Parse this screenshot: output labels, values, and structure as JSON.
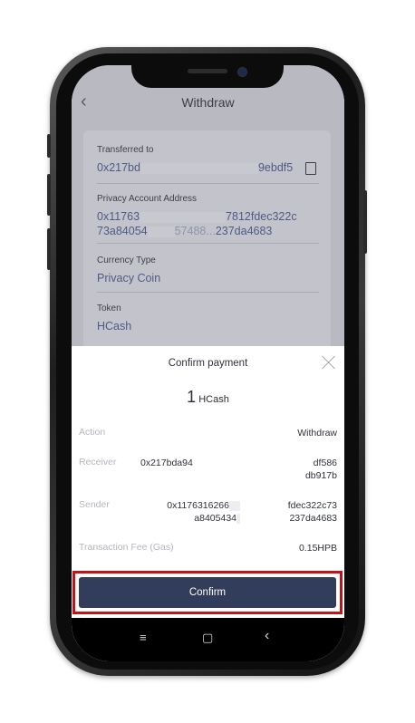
{
  "header": {
    "title": "Withdraw",
    "back_icon": "chevron-left-icon"
  },
  "form": {
    "transferred_to": {
      "label": "Transferred to",
      "value_start": "0x217bd",
      "value_end": "9ebdf5"
    },
    "privacy_address": {
      "label": "Privacy Account Address",
      "line1_start": "0x11763",
      "line1_end": "7812fdec322c",
      "line2_start": "73a84054",
      "line2_mid": "57488...",
      "line2_end": "237da4683"
    },
    "currency_type": {
      "label": "Currency Type",
      "value": "Privacy Coin"
    },
    "token": {
      "label": "Token",
      "value": "HCash"
    }
  },
  "sheet": {
    "title": "Confirm payment",
    "amount": "1",
    "unit": "HCash",
    "action_label": "Action",
    "action_value": "Withdraw",
    "receiver_label": "Receiver",
    "receiver_start": "0x217bda94",
    "receiver_end1": "df586",
    "receiver_end2": "db917b",
    "sender_label": "Sender",
    "sender_start": "0x1176316266",
    "sender_mid": "a8405434",
    "sender_end1": "fdec322c73",
    "sender_end2": "237da4683",
    "fee_label": "Transaction Fee (Gas)",
    "fee_value": "0.15HPB",
    "confirm_label": "Confirm"
  },
  "navbar": {
    "menu": "≡",
    "home": "▢",
    "back": "‹"
  }
}
